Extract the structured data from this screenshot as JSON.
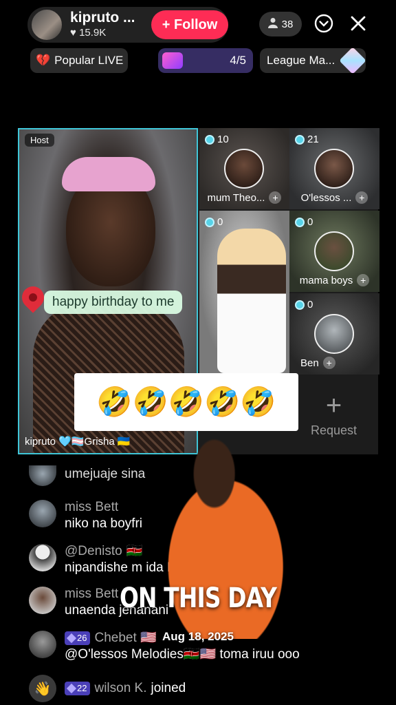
{
  "header": {
    "host_name": "kipruto ...",
    "likes": "15.9K",
    "follow_label": "+ Follow",
    "viewer_count": "38"
  },
  "tags": {
    "popular": "Popular LIVE",
    "rank": "4/5",
    "league": "League Ma..."
  },
  "grid": {
    "host_label": "Host",
    "host_caption": "kipruto 🩵🏳️‍⚧️Grisha 🇺🇦",
    "birthday_text": "happy birthday to me",
    "emojis": "🤣🤣🤣🤣🤣",
    "guests": [
      {
        "coins": "10",
        "name": "mum Theo..."
      },
      {
        "coins": "21",
        "name": "O'lessos ..."
      },
      {
        "coins": "0",
        "name": ""
      },
      {
        "coins": "0",
        "name": "mama boys"
      },
      {
        "coins": "0",
        "name": "Ben"
      }
    ],
    "request_label": "Request"
  },
  "comments": [
    {
      "user": "",
      "level": "",
      "text": "umejuaje sina"
    },
    {
      "user": "miss Bett",
      "level": "",
      "text": "niko na boyfri"
    },
    {
      "user": "@Denisto",
      "level": "",
      "text": "nipandishe m                        ida Iko wpi😁"
    },
    {
      "user": "miss Bett",
      "level": "",
      "text": "unaenda jenanani"
    },
    {
      "user": "Chebet 🇺🇸",
      "level": "26",
      "text": "@O'lessos Melodies🇰🇪🇺🇸 toma iruu ooo"
    },
    {
      "user": "wilson K.",
      "level": "22",
      "text": "joined"
    }
  ],
  "overlay": {
    "title": "ON THIS DAY",
    "date": "Aug 18, 2025"
  }
}
